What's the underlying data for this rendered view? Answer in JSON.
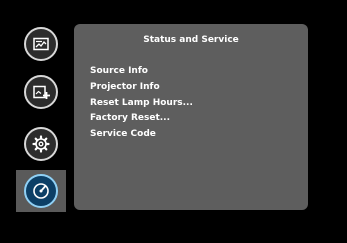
{
  "sidebar": {
    "items": [
      {
        "icon": "image-settings-icon",
        "active": false
      },
      {
        "icon": "advanced-settings-icon",
        "active": false
      },
      {
        "icon": "gear-icon",
        "active": false
      },
      {
        "icon": "service-gauge-icon",
        "active": true
      }
    ]
  },
  "panel": {
    "title": "Status and Service",
    "items": [
      {
        "label": "Source Info"
      },
      {
        "label": "Projector Info"
      },
      {
        "label": "Reset Lamp Hours..."
      },
      {
        "label": "Factory Reset..."
      },
      {
        "label": "Service Code"
      }
    ]
  },
  "colors": {
    "background": "#000000",
    "panel": "#5e5e5e",
    "active_tab": "#5a5a5a",
    "active_icon_fill": "#0c3f66",
    "active_icon_ring": "#8fd0f5",
    "text": "#ffffff"
  }
}
